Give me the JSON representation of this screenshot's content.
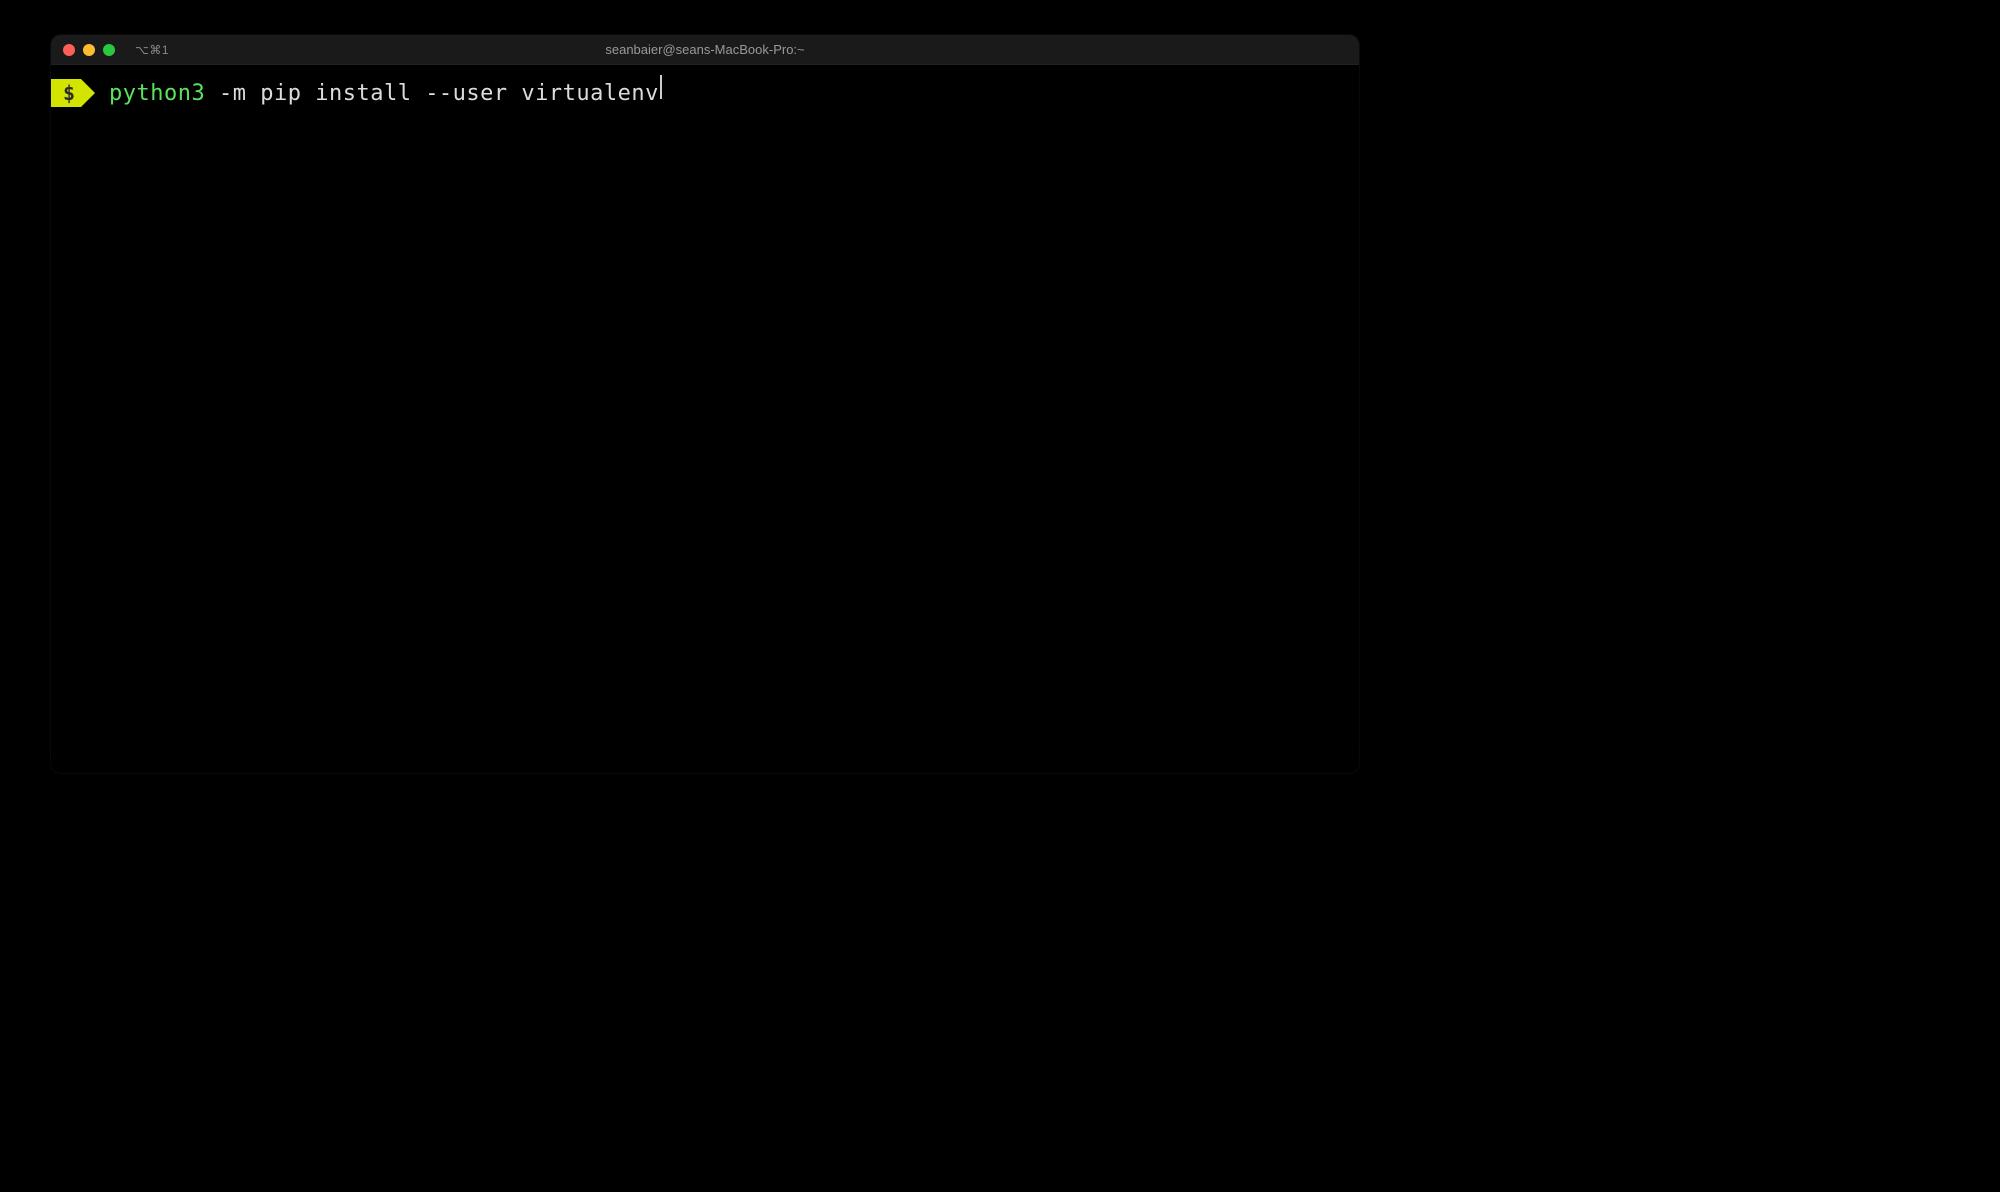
{
  "window": {
    "title": "seanbaier@seans-MacBook-Pro:~",
    "tab_label": "⌥⌘1"
  },
  "prompt": {
    "symbol": "$"
  },
  "command": {
    "executable": "python3",
    "arguments": " -m pip install --user virtualenv"
  },
  "colors": {
    "prompt_bg": "#d3e400",
    "executable": "#5be35b",
    "args": "#dcdcdc",
    "close": "#ff5f57",
    "minimize": "#febc2e",
    "maximize": "#28c840"
  }
}
